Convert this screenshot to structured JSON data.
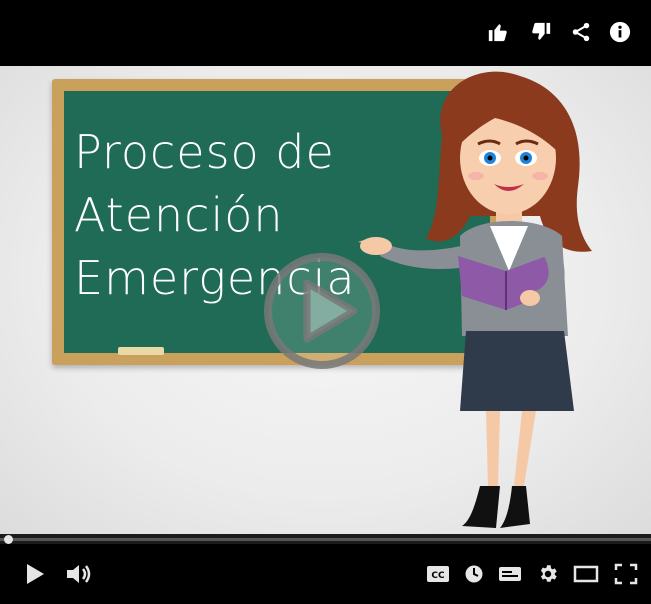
{
  "video": {
    "board_lines": [
      "Proceso de",
      "Atención",
      "Emergencia"
    ]
  },
  "colors": {
    "chalkboard": "#1f6b55",
    "board_frame": "#c9a05c",
    "controls_bg": "#000000",
    "icon": "#e6e6e6"
  },
  "top_icons": [
    "thumbs-up-icon",
    "thumbs-down-icon",
    "share-icon",
    "info-icon"
  ],
  "control_icons": [
    "play-icon",
    "volume-icon",
    "closed-captions-icon",
    "watch-later-icon",
    "subtitles-icon",
    "settings-icon",
    "theater-mode-icon",
    "fullscreen-icon"
  ],
  "progress": {
    "played_fraction": 0.0
  }
}
